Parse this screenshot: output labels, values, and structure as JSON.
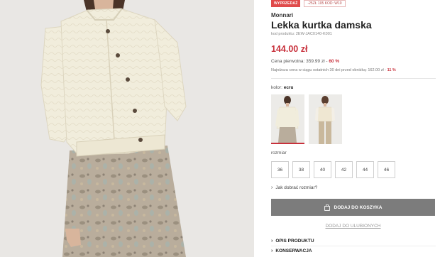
{
  "badges": {
    "sale": "WYPRZEDAŻ",
    "code": "-25ZŁ 105 KOD: W10"
  },
  "product": {
    "brand": "Monnari",
    "title": "Lekka kurtka damska",
    "code": "kod produktu: 2EW-JAC0140-K001",
    "price": "144.00 zł",
    "original_price_label": "Cena pierwotna: 359.99 zł - ",
    "original_discount": "60 %",
    "lowest_price_label": "Najniższa cena w ciągu ostatnich 30 dni przed obniżką: 162.00 zł - ",
    "lowest_discount": "11 %"
  },
  "color": {
    "label": "kolor: ",
    "value": "ecru"
  },
  "size": {
    "label": "rozmiar",
    "options": [
      "36",
      "38",
      "40",
      "42",
      "44",
      "46"
    ]
  },
  "actions": {
    "size_guide": "Jak dobrać rozmiar?",
    "add_to_cart": "DODAJ DO KOSZYKA",
    "add_to_favorites": "DODAJ DO ULUBIONYCH"
  },
  "accordion": [
    "OPIS PRODUKTU",
    "KONSERWACJA"
  ],
  "colors": {
    "accent": "#c8313c",
    "button": "#7c7c7c",
    "photo_bg": "#e9e7e4"
  }
}
